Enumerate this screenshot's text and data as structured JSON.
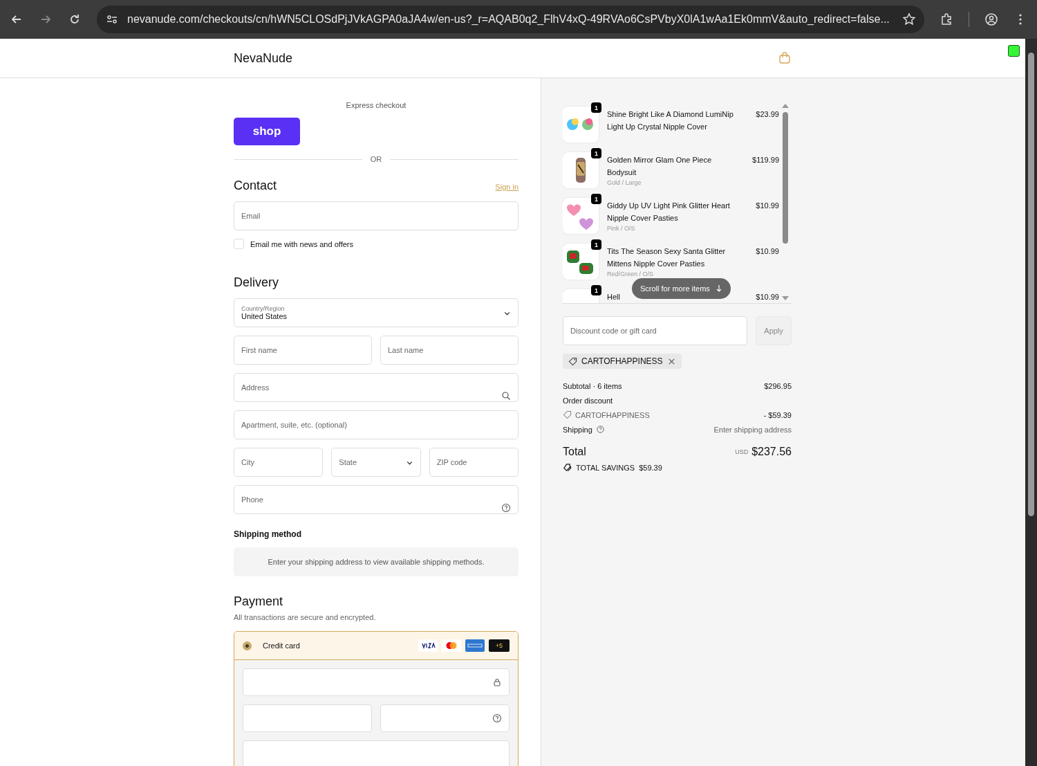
{
  "browser": {
    "url": "nevanude.com/checkouts/cn/hWN5CLOSdPjJVkAGPA0aJA4w/en-us?_r=AQAB0q2_FlhV4xQ-49RVAo6CsPVbyX0lA1wAa1Ek0mmV&auto_redirect=false..."
  },
  "header": {
    "brand": "NevaNude"
  },
  "express": {
    "title": "Express checkout",
    "shop_button": "shop",
    "divider": "OR"
  },
  "contact": {
    "title": "Contact",
    "sign_in": "Sign in",
    "email": {
      "placeholder": "Email"
    },
    "newsletter": {
      "label": "Email me with news and offers",
      "checked": false
    }
  },
  "delivery": {
    "title": "Delivery",
    "country": {
      "label": "Country/Region",
      "value": "United States"
    },
    "first_name": {
      "placeholder": "First name"
    },
    "last_name": {
      "placeholder": "Last name"
    },
    "address": {
      "placeholder": "Address"
    },
    "apartment": {
      "placeholder": "Apartment, suite, etc. (optional)"
    },
    "city": {
      "placeholder": "City"
    },
    "state": {
      "placeholder": "State"
    },
    "zip": {
      "placeholder": "ZIP code"
    },
    "phone": {
      "placeholder": "Phone"
    }
  },
  "shipping_method": {
    "title": "Shipping method",
    "notice": "Enter your shipping address to view available shipping methods."
  },
  "payment": {
    "title": "Payment",
    "subtitle": "All transactions are secure and encrypted.",
    "option": {
      "label": "Credit card",
      "selected": true,
      "more_cards": "+5"
    }
  },
  "cart": {
    "items": [
      {
        "title": "Shine Bright Like A Diamond LumiNip Light Up Crystal Nipple Cover",
        "price": "$23.99",
        "qty": "1"
      },
      {
        "title": "Golden Mirror Glam One Piece Bodysuit",
        "variant": "Gold / Large",
        "price": "$119.99",
        "qty": "1"
      },
      {
        "title": "Giddy Up UV Light Pink Glitter Heart Nipple Cover Pasties",
        "variant": "Pink / O/S",
        "price": "$10.99",
        "qty": "1"
      },
      {
        "title": "Tits The Season Sexy Santa Glitter Mittens Nipple Cover Pasties",
        "variant": "Red/Green / O/S",
        "price": "$10.99",
        "qty": "1"
      },
      {
        "title": "Hell",
        "price": "$10.99",
        "qty": "1"
      }
    ],
    "scroll_hint": "Scroll for more items"
  },
  "discount": {
    "placeholder": "Discount code or gift card",
    "apply": "Apply",
    "applied_code": "CARTOFHAPPINESS"
  },
  "summary": {
    "subtotal_label": "Subtotal · 6 items",
    "subtotal": "$296.95",
    "order_discount": "Order discount",
    "discount_code": "CARTOFHAPPINESS",
    "discount_amount": "- $59.39",
    "shipping_label": "Shipping",
    "shipping_value": "Enter shipping address",
    "total_label": "Total",
    "currency": "USD",
    "total": "$237.56",
    "savings_label": "TOTAL SAVINGS",
    "savings": "$59.39"
  }
}
